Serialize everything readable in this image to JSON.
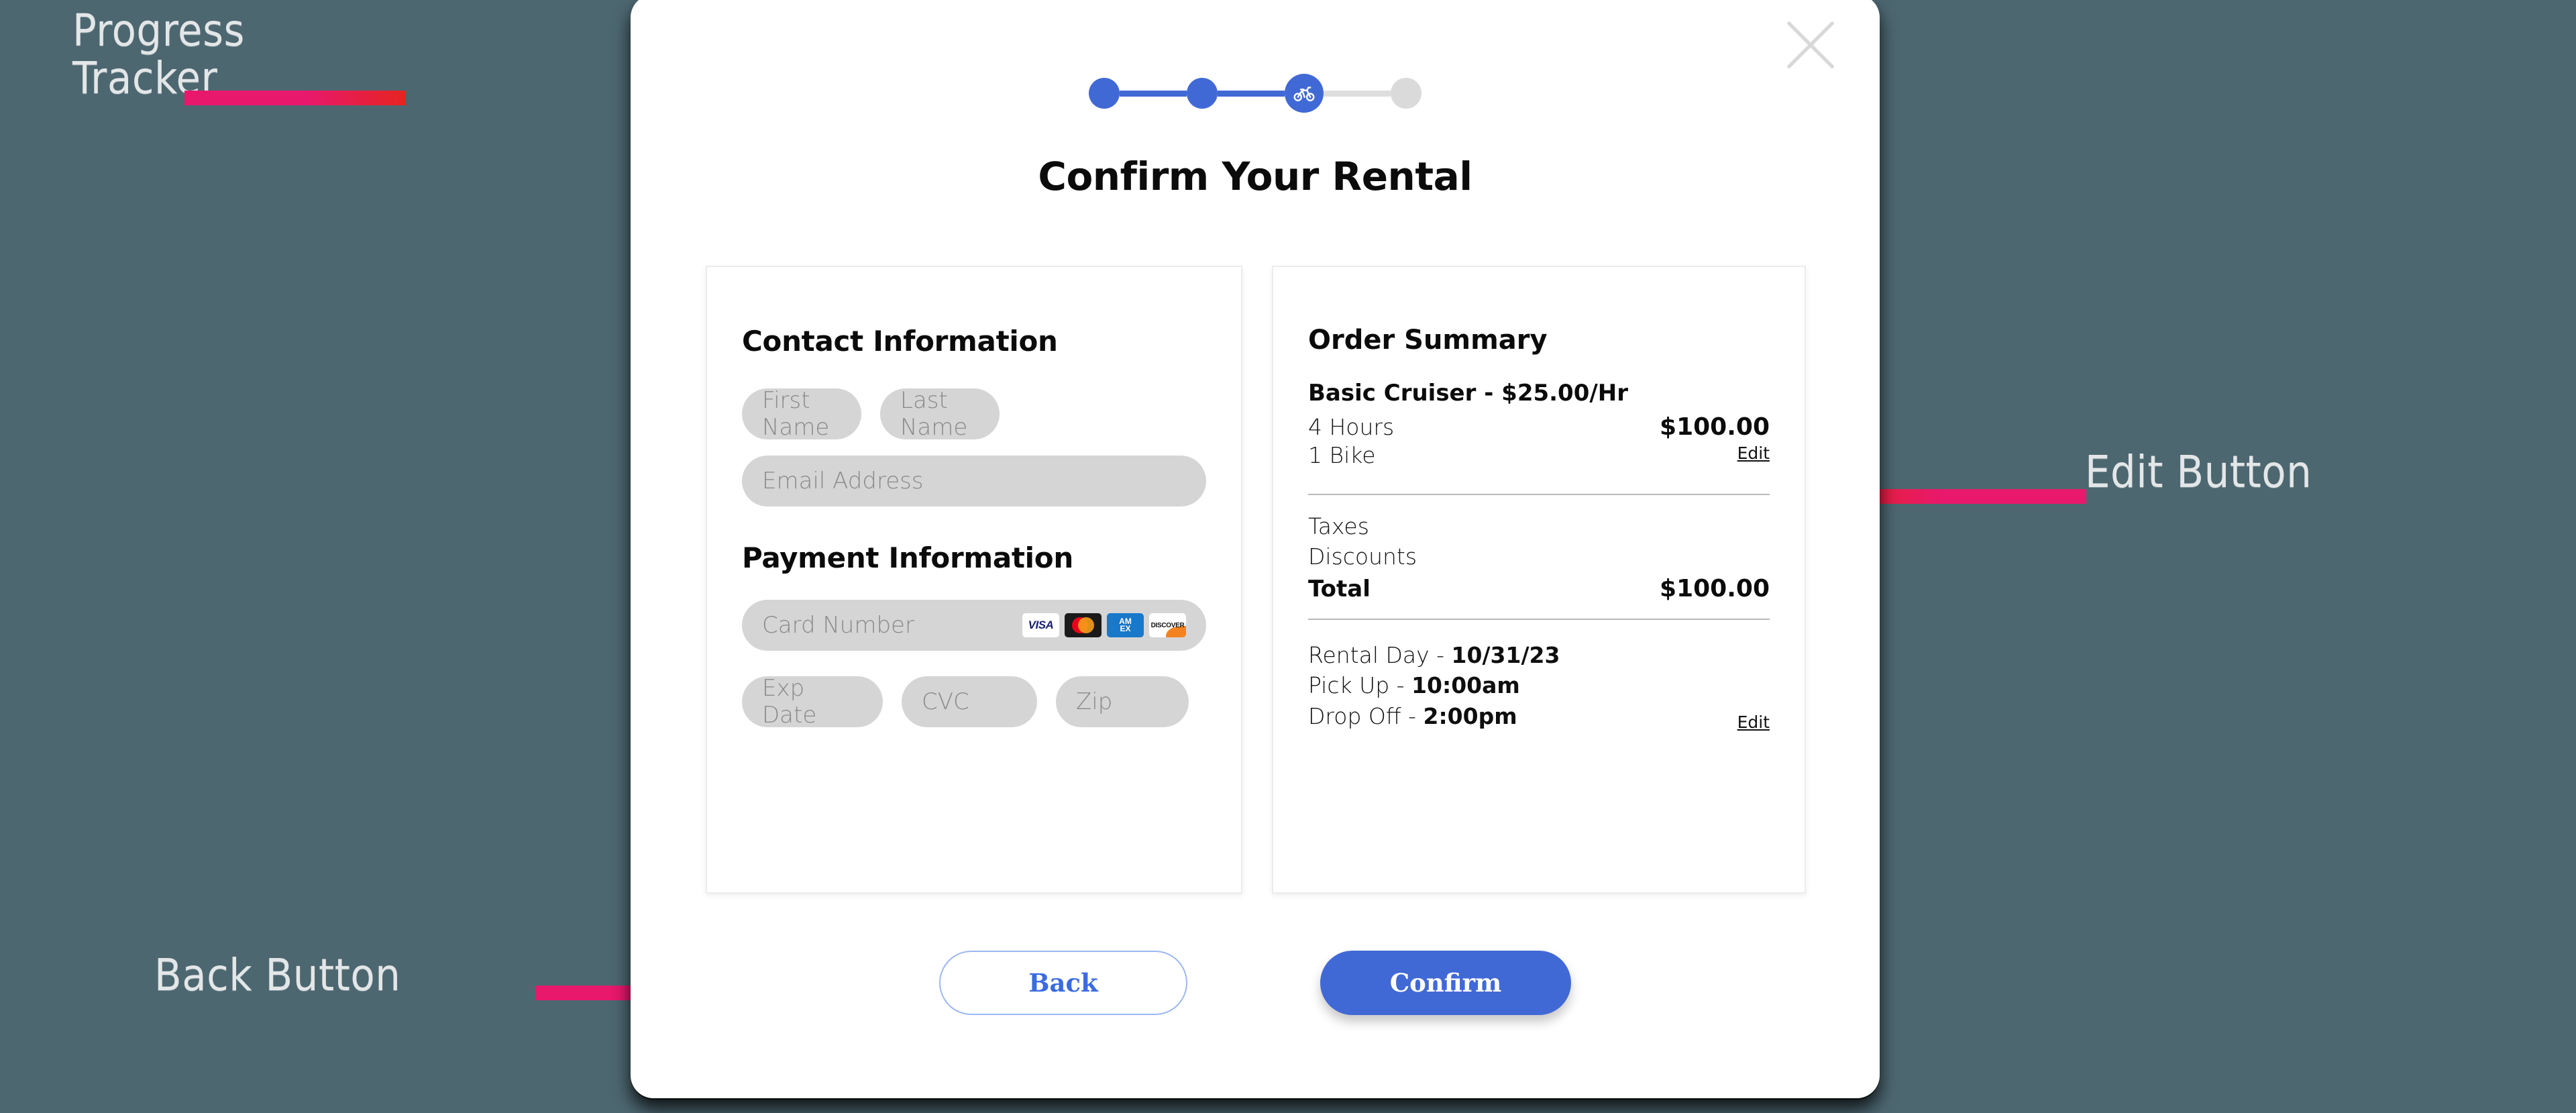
{
  "annotations": [
    {
      "label": "Progress\nTracker",
      "name": "progress-tracker"
    },
    {
      "label": "Edit Button",
      "name": "edit-button"
    },
    {
      "label": "Back Button",
      "name": "back-button"
    }
  ],
  "modal": {
    "title": "Confirm Your Rental",
    "close_icon": "close-x-icon"
  },
  "tracker": {
    "steps": [
      {
        "state": "complete",
        "icon": ""
      },
      {
        "state": "complete",
        "icon": ""
      },
      {
        "state": "current",
        "icon": "bicycle-icon"
      },
      {
        "state": "upcoming",
        "icon": ""
      }
    ]
  },
  "contact": {
    "heading": "Contact Information",
    "first_name_placeholder": "First Name",
    "last_name_placeholder": "Last Name",
    "email_placeholder": "Email Address",
    "first_name_value": "",
    "last_name_value": "",
    "email_value": ""
  },
  "payment": {
    "heading": "Payment Information",
    "card_placeholder": "Card Number",
    "card_value": "",
    "exp_placeholder": "Exp Date",
    "exp_value": "",
    "cvc_placeholder": "CVC",
    "cvc_value": "",
    "zip_placeholder": "Zip",
    "zip_value": "",
    "card_brands": [
      "VISA",
      "Mastercard",
      "AMEX",
      "DISCOVER"
    ],
    "amex_line1": "AM",
    "amex_line2": "EX",
    "visa_label": "VISA",
    "discover_label": "DISCOVER"
  },
  "order": {
    "heading": "Order Summary",
    "item_name": "Basic Cruiser - $25.00/Hr",
    "duration": "4 Hours",
    "quantity": "1 Bike",
    "item_price": "$100.00",
    "item_edit": "Edit",
    "taxes_label": "Taxes",
    "taxes_value": "",
    "discounts_label": "Discounts",
    "discounts_value": "",
    "total_label": "Total",
    "total_value": "$100.00",
    "rental_day_label": "Rental Day - ",
    "rental_day_value": "10/31/23",
    "pickup_label": "Pick Up - ",
    "pickup_value": "10:00am",
    "dropoff_label": "Drop Off - ",
    "dropoff_value": "2:00pm",
    "schedule_edit": "Edit"
  },
  "footer": {
    "back_label": "Back",
    "confirm_label": "Confirm"
  },
  "colors": {
    "background": "#4D6771",
    "accent_blue": "#4169D6",
    "annotation_red": "#E52421",
    "annotation_pink": "#E8186C",
    "field_gray": "#D5D5D5"
  }
}
